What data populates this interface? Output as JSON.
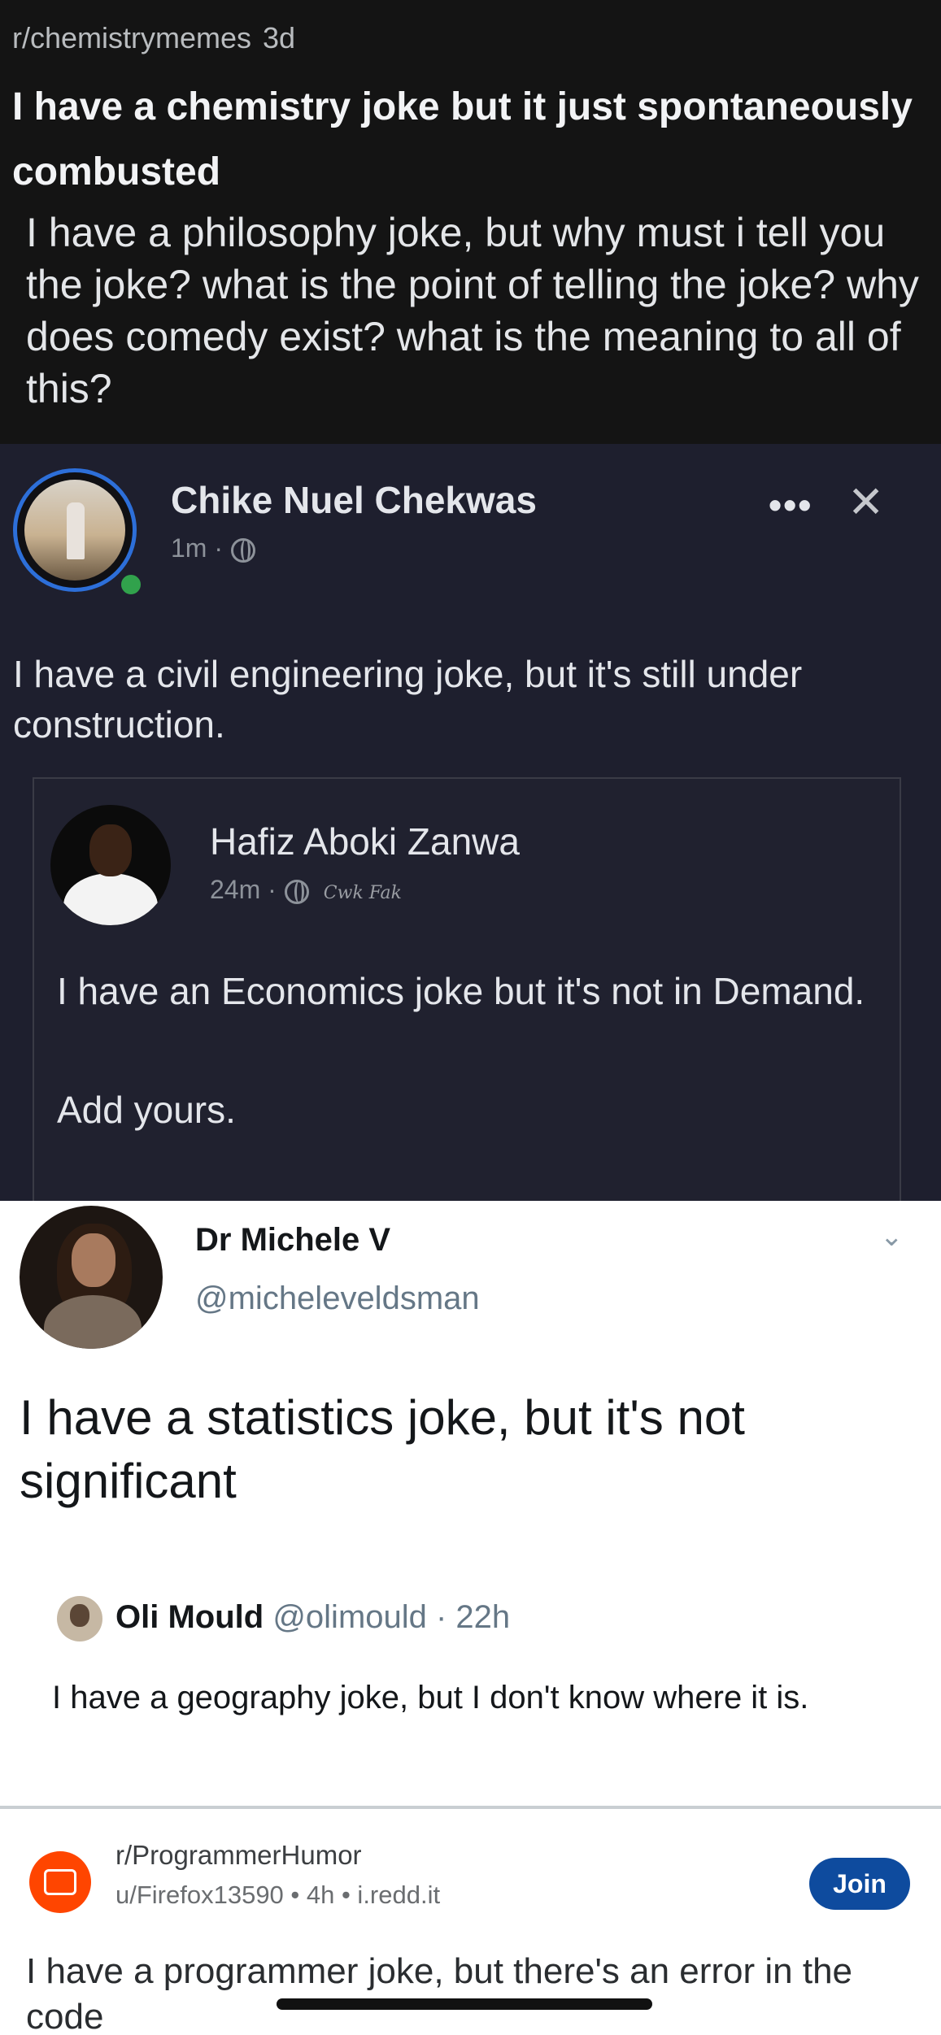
{
  "reddit_post": {
    "subreddit": "r/chemistrymemes",
    "age": "3d",
    "title": "I have a chemistry joke but it just spontaneously combusted",
    "body": "I have a philosophy joke, but why must i tell you the joke? what is the point of telling the joke? why does comedy exist? what is the meaning to all of this?"
  },
  "facebook_post": {
    "author": "Chike Nuel Chekwas",
    "time": "1m ·",
    "more_label": "•••",
    "close_label": "✕",
    "text": "I have a civil engineering joke, but it's still under construction.",
    "shared": {
      "author": "Hafiz Aboki Zanwa",
      "time": "24m ·",
      "signature": "Cwk Fak",
      "text": "I have an Economics joke but it's not in Demand.",
      "cta": "Add yours."
    }
  },
  "tweet": {
    "name": "Dr Michele V",
    "handle": "@micheleveldsman",
    "text": "I have a statistics joke, but it's not significant",
    "quoted": {
      "name": "Oli Mould",
      "meta": "@olimould · 22h",
      "text": "I have a geography joke, but I don't know where it is."
    }
  },
  "reddit_card": {
    "subreddit": "r/ProgrammerHumor",
    "meta": "u/Firefox13590 • 4h • i.redd.it",
    "join_label": "Join",
    "text": "I have a programmer joke, but there's an error in the code"
  }
}
